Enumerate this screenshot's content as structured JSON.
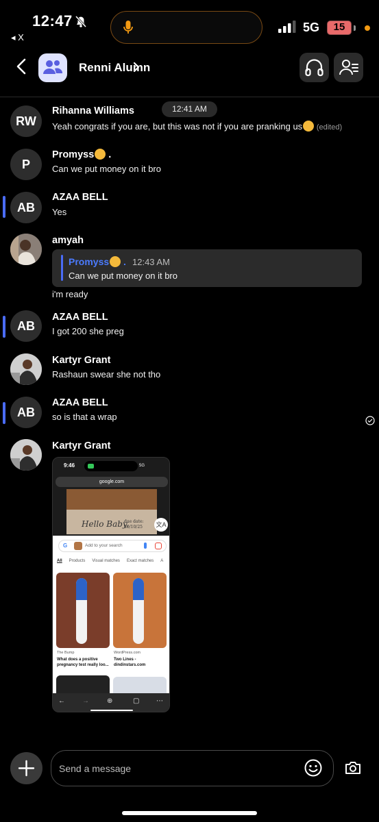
{
  "status_bar": {
    "time": "12:47",
    "back_label": "◂ X",
    "network": "5G",
    "battery": "15",
    "icons": [
      "bell-slash-icon",
      "microphone-icon",
      "signal-icon",
      "battery-icon"
    ]
  },
  "header": {
    "title": "Renni Alumn",
    "icons": [
      "back-chevron-icon",
      "group-icon",
      "chevron-right-icon",
      "headphones-icon",
      "members-icon"
    ]
  },
  "timestamp_pill": "12:41 AM",
  "messages": [
    {
      "initials": "RW",
      "sender": "Rihanna Williams",
      "text": "Yeah congrats if you are, but this was not if you are pranking us",
      "edited": "(edited)"
    },
    {
      "initials": "P",
      "sender": "Promyss",
      "sender_suffix": ".",
      "text": "Can we put money on it bro"
    },
    {
      "initials": "AB",
      "sender": "AZAA BELL",
      "text": "Yes"
    },
    {
      "sender": "amyah",
      "reply": {
        "name": "Promyss",
        "suffix": ".",
        "time": "12:43 AM",
        "text": "Can we put money on it bro"
      },
      "text": "i'm ready"
    },
    {
      "initials": "AB",
      "sender": "AZAA BELL",
      "text": "I got 200 she preg"
    },
    {
      "sender": "Kartyr Grant",
      "text": "Rashaun swear she not tho"
    },
    {
      "initials": "AB",
      "sender": "AZAA BELL",
      "text": "so is that a wrap"
    },
    {
      "sender": "Kartyr Grant"
    }
  ],
  "attachment": {
    "time": "9:46",
    "signal": "5G",
    "url": "google.com",
    "card_script": "Hello Baby,",
    "card_due": "due date:",
    "card_date": "10/10/25",
    "search_placeholder": "Add to your search",
    "tabs": [
      "All",
      "Products",
      "Visual matches",
      "Exact matches",
      "A"
    ],
    "result1_source": "The Bump",
    "result1_title_1": "What does a positive",
    "result1_title_2": "pregnancy test really loo...",
    "result2_source": "WordPress.com",
    "result2_title_1": "Two Lines -",
    "result2_title_2": "dindinstars.com"
  },
  "composer": {
    "placeholder": "Send a message",
    "icons": [
      "plus-icon",
      "smiley-icon",
      "camera-icon"
    ]
  },
  "colors": {
    "background": "#000000",
    "mention": "#4a6cf7",
    "reply_name": "#4b7bff",
    "battery": "#e96a6a",
    "island_ring": "#7a4a14"
  }
}
